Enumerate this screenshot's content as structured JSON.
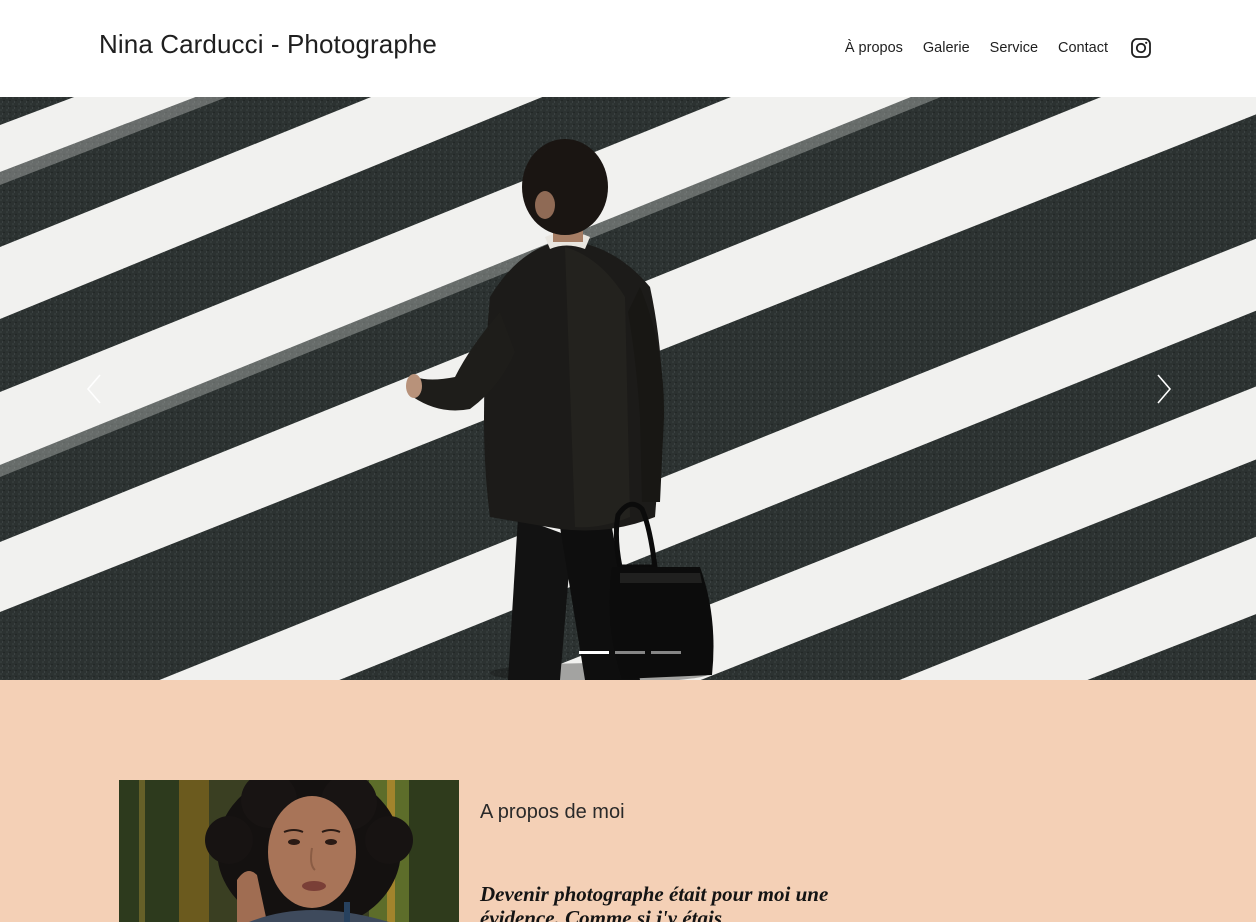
{
  "header": {
    "site_title": "Nina Carducci - Photographe",
    "nav": [
      {
        "label": "À propos"
      },
      {
        "label": "Galerie"
      },
      {
        "label": "Service"
      },
      {
        "label": "Contact"
      }
    ],
    "social_icon": "instagram-icon"
  },
  "carousel": {
    "slide_count": 3,
    "active_index": 0,
    "prev_icon": "chevron-left-icon",
    "next_icon": "chevron-right-icon"
  },
  "about": {
    "heading": "A propos de moi",
    "quote": "Devenir photographe était pour moi une évidence. Comme si j'y étais"
  },
  "colors": {
    "about_background": "#f4d0b6",
    "text": "#1f1f1f"
  }
}
